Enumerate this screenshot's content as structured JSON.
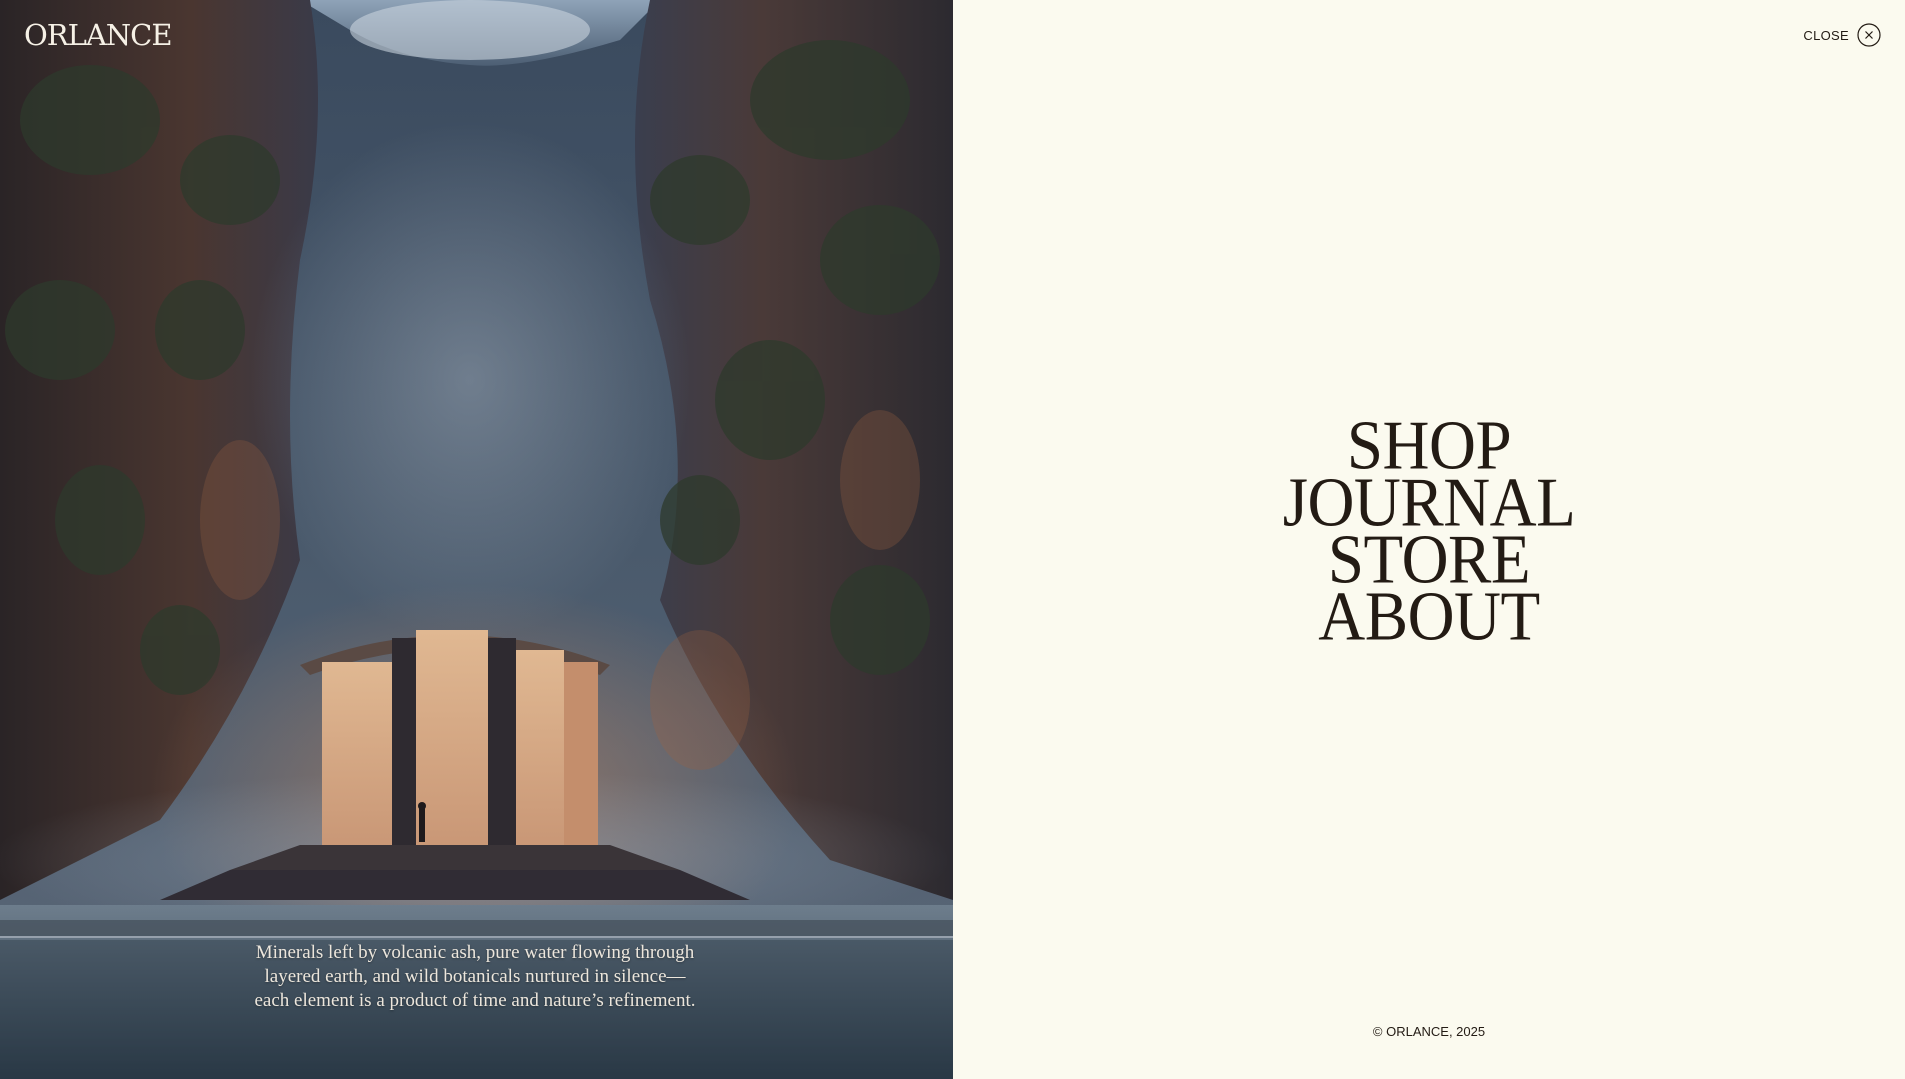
{
  "brand": {
    "logo_text": "ORLANCE"
  },
  "hero": {
    "image_alt": "canyon-temple-image",
    "caption": "Minerals left by volcanic ash, pure water flowing through layered earth, and wild botanicals nurtured in silence—each element is a product of time and nature’s refinement."
  },
  "menu": {
    "close_label": "CLOSE",
    "close_icon": "close-icon",
    "items": [
      {
        "label": "SHOP"
      },
      {
        "label": "JOURNAL"
      },
      {
        "label": "STORE"
      },
      {
        "label": "ABOUT"
      }
    ],
    "footer": "© ORLANCE, 2025"
  },
  "colors": {
    "panel_bg": "#fbfaef",
    "text_dark": "#231b14",
    "logo_light": "#f6f1e6"
  }
}
